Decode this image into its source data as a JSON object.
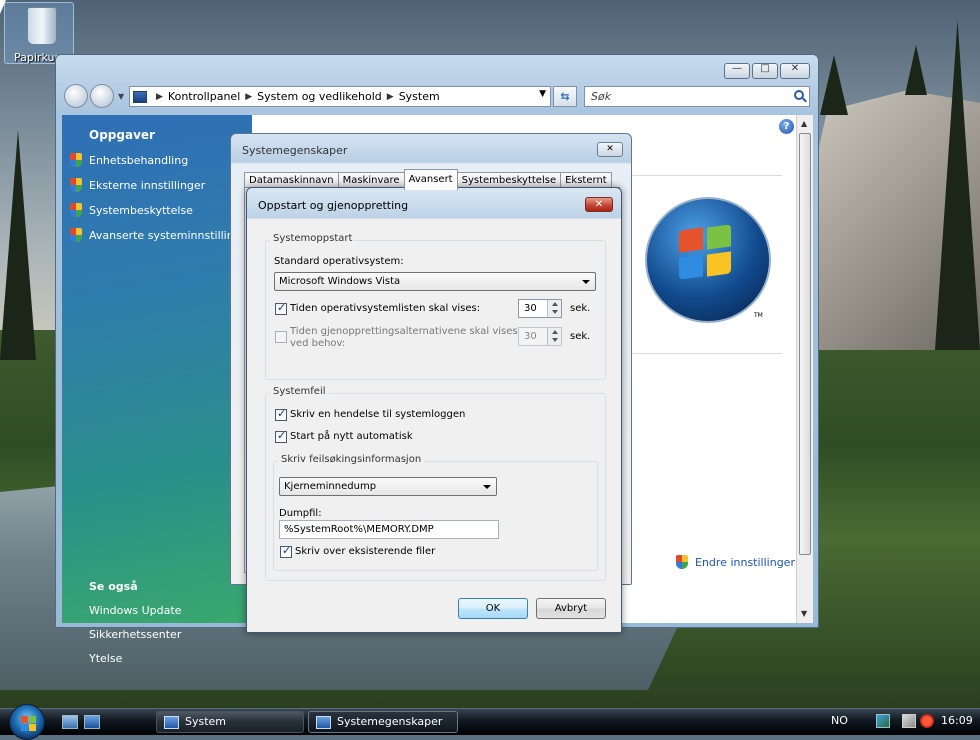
{
  "desktop": {
    "recycle_bin_label": "Papirkurv"
  },
  "explorer": {
    "window_controls": {
      "minimize": "—",
      "maximize": "□",
      "close": "✕"
    },
    "address": {
      "root": "Kontrollpanel",
      "middle": "System og vedlikehold",
      "leaf": "System"
    },
    "search_placeholder": "Søk",
    "tasks_title": "Oppgaver",
    "tasks": [
      "Enhetsbehandling",
      "Eksterne innstillinger",
      "Systembeskyttelse",
      "Avanserte systeminnstillinger"
    ],
    "see_also_title": "Se også",
    "see_also": [
      "Windows Update",
      "Sikkerhetssenter",
      "Ytelse"
    ],
    "change_settings": "Endre innstillinger",
    "trademark": "TM",
    "help": "?"
  },
  "system_properties": {
    "title": "Systemegenskaper",
    "close": "✕",
    "tabs": [
      "Datamaskinnavn",
      "Maskinvare",
      "Avansert",
      "Systembeskyttelse",
      "Eksternt"
    ],
    "active_tab": "Avansert"
  },
  "startup_recovery": {
    "title": "Oppstart og gjenoppretting",
    "close": "✕",
    "system_startup": {
      "group_label": "Systemoppstart",
      "default_os_label": "Standard operativsystem:",
      "default_os_value": "Microsoft Windows Vista",
      "show_os_list_label": "Tiden operativsystemlisten skal vises:",
      "show_os_list_checked": true,
      "show_os_list_value": "30",
      "show_recovery_label_1": "Tiden gjenopprettingsalternativene skal vises,",
      "show_recovery_label_2": "ved behov:",
      "show_recovery_checked": false,
      "show_recovery_value": "30",
      "unit": "sek."
    },
    "system_failure": {
      "group_label": "Systemfeil",
      "write_event_label": "Skriv en hendelse til systemloggen",
      "write_event_checked": true,
      "auto_restart_label": "Start på nytt automatisk",
      "auto_restart_checked": true,
      "debug_group_label": "Skriv feilsøkingsinformasjon",
      "debug_type_value": "Kjerneminnedump",
      "dump_file_label": "Dumpfil:",
      "dump_file_value": "%SystemRoot%\\MEMORY.DMP",
      "overwrite_label": "Skriv over eksisterende filer",
      "overwrite_checked": true
    },
    "ok_label": "OK",
    "cancel_label": "Avbryt"
  },
  "taskbar": {
    "items": [
      {
        "label": "System",
        "active": false
      },
      {
        "label": "Systemegenskaper",
        "active": true
      }
    ],
    "language": "NO",
    "clock": "16:09"
  },
  "colors": {
    "task_pane_top": "#2f6fb5",
    "task_pane_bottom": "#3aa86e",
    "link_blue": "#1f55b3",
    "close_red": "#c24130"
  }
}
